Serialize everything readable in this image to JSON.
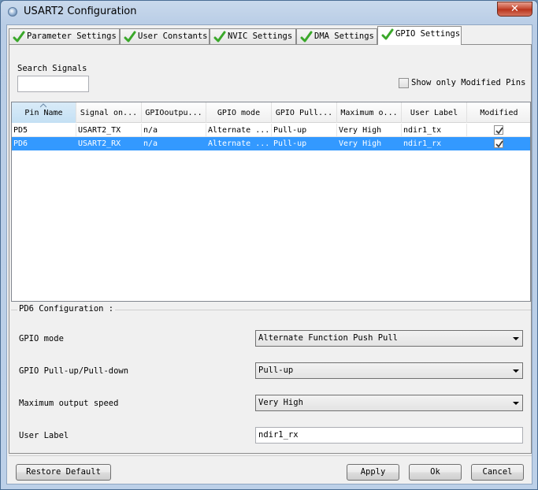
{
  "window": {
    "title": "USART2 Configuration",
    "close_label": "✕"
  },
  "tabs": [
    {
      "label": "Parameter Settings",
      "icon": "check-icon",
      "active": false
    },
    {
      "label": "User Constants",
      "icon": "check-icon",
      "active": false
    },
    {
      "label": "NVIC Settings",
      "icon": "check-icon",
      "active": false
    },
    {
      "label": "DMA Settings",
      "icon": "check-icon",
      "active": false
    },
    {
      "label": "GPIO Settings",
      "icon": "check-icon",
      "active": true
    }
  ],
  "search": {
    "label": "Search Signals",
    "value": ""
  },
  "filter": {
    "label": "Show only Modified Pins",
    "checked": false
  },
  "table": {
    "columns": [
      "Pin Name",
      "Signal on...",
      "GPIOoutpu...",
      "GPIO mode",
      "GPIO Pull...",
      "Maximum o...",
      "User Label",
      "Modified"
    ],
    "rows": [
      {
        "cells": [
          "PD5",
          "USART2_TX",
          "n/a",
          "Alternate ...",
          "Pull-up",
          "Very High",
          "ndir1_tx"
        ],
        "modified": true,
        "selected": false
      },
      {
        "cells": [
          "PD6",
          "USART2_RX",
          "n/a",
          "Alternate ...",
          "Pull-up",
          "Very High",
          "ndir1_rx"
        ],
        "modified": true,
        "selected": true
      }
    ]
  },
  "config": {
    "title": "PD6 Configuration :",
    "fields": [
      {
        "label": "GPIO mode",
        "value": "Alternate Function Push Pull",
        "kind": "combo"
      },
      {
        "label": "GPIO Pull-up/Pull-down",
        "value": "Pull-up",
        "kind": "combo"
      },
      {
        "label": "Maximum output speed",
        "value": "Very High",
        "kind": "combo"
      },
      {
        "label": "User Label",
        "value": "ndir1_rx",
        "kind": "text"
      }
    ]
  },
  "buttons": {
    "restore_default": "Restore Default",
    "apply": "Apply",
    "ok": "Ok",
    "cancel": "Cancel"
  },
  "colors": {
    "selection": "#3399ff",
    "check_green": "#3aa82a",
    "close_red": "#c4452c"
  }
}
